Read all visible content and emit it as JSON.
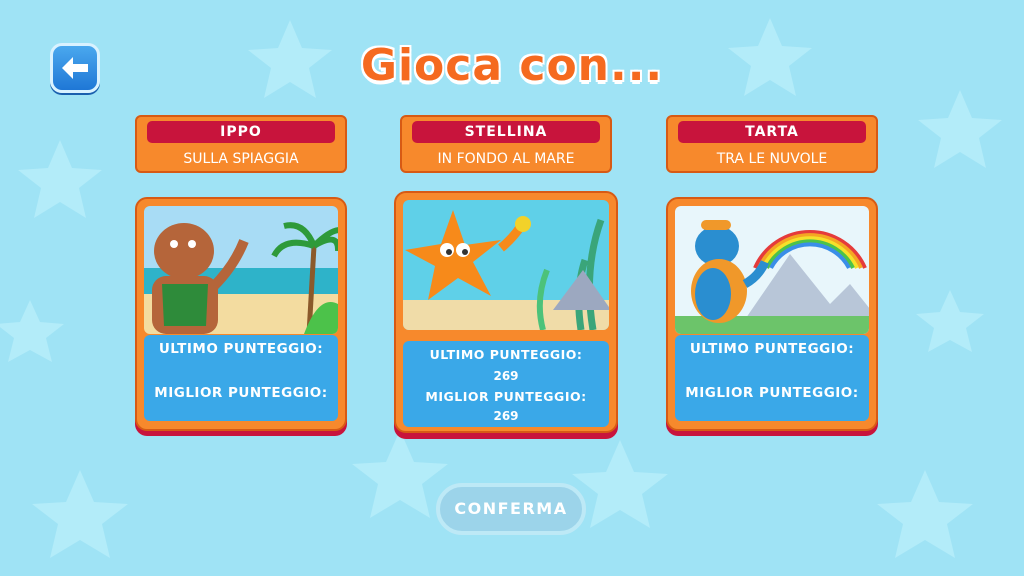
{
  "title": "Gioca con...",
  "colors": {
    "accent": "#f7892c",
    "name_bar": "#c8143c",
    "score_panel": "#3aa8e8",
    "background": "#9fe3f5"
  },
  "back_button": {
    "icon": "arrow-left-icon"
  },
  "cards": [
    {
      "name": "IPPO",
      "place": "SULLA SPIAGGIA",
      "last_label": "ULTIMO PUNTEGGIO:",
      "last_value": "",
      "best_label": "MIGLIOR PUNTEGGIO:",
      "best_value": ""
    },
    {
      "name": "STELLINA",
      "place": "IN FONDO AL MARE",
      "last_label": "ULTIMO PUNTEGGIO:",
      "last_value": "269",
      "best_label": "MIGLIOR PUNTEGGIO:",
      "best_value": "269"
    },
    {
      "name": "TARTA",
      "place": "TRA LE NUVOLE",
      "last_label": "ULTIMO PUNTEGGIO:",
      "last_value": "",
      "best_label": "MIGLIOR PUNTEGGIO:",
      "best_value": ""
    }
  ],
  "confirm_label": "CONFERMA"
}
